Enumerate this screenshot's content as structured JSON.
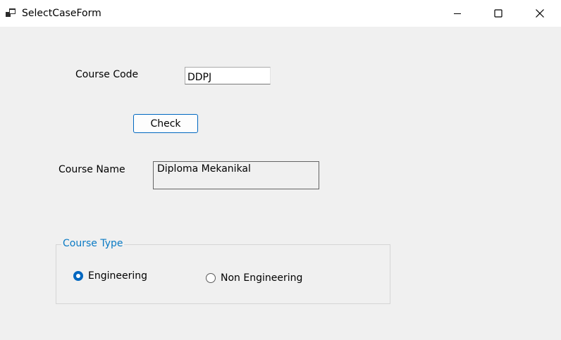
{
  "window": {
    "title": "SelectCaseForm",
    "minimize_icon": "minimize-icon",
    "maximize_icon": "maximize-icon",
    "close_icon": "close-icon",
    "app_icon": "app-window-icon"
  },
  "form": {
    "course_code_label": "Course Code",
    "course_code_value": "DDPJ",
    "check_button_label": "Check",
    "course_name_label": "Course Name",
    "course_name_value": "Diploma Mekanikal",
    "course_type": {
      "legend": "Course Type",
      "legend_color": "#0a7ac4",
      "options": [
        {
          "label": "Engineering",
          "checked": true
        },
        {
          "label": "Non Engineering",
          "checked": false
        }
      ]
    }
  },
  "colors": {
    "accent": "#0067c0",
    "form_background": "#f0f0f0",
    "titlebar_background": "#ffffff"
  }
}
